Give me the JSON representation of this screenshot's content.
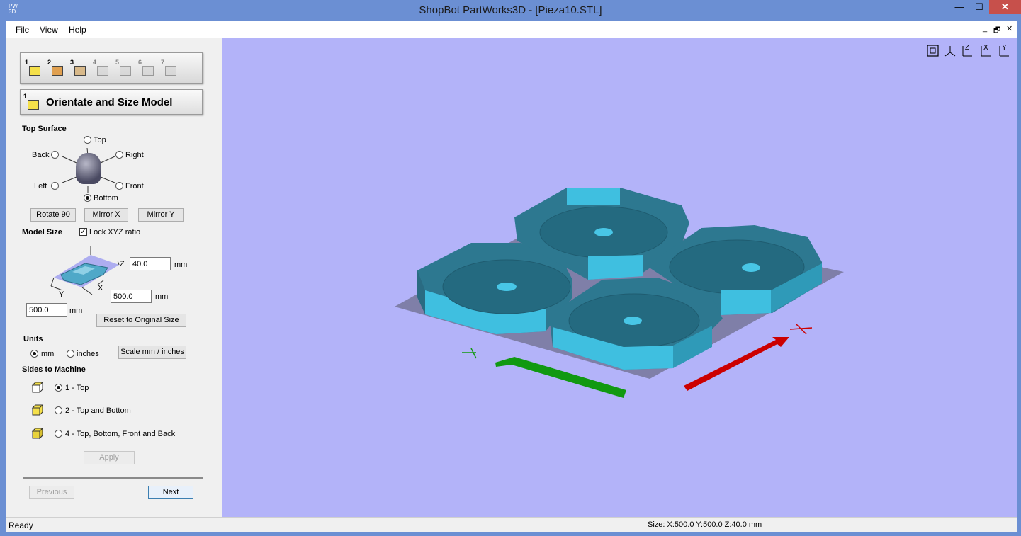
{
  "window": {
    "title": "ShopBot PartWorks3D - [Pieza10.STL]",
    "app_icon_text": "PW\n3D",
    "minimize": "—",
    "maximize": "☐",
    "close": "✕"
  },
  "menu": {
    "items": [
      "File",
      "View",
      "Help"
    ],
    "mdi_controls": [
      "_",
      "🗗",
      "✕"
    ]
  },
  "wizard": {
    "steps": [
      "1",
      "2",
      "3",
      "4",
      "5",
      "6",
      "7"
    ],
    "heading_number": "1",
    "heading": "Orientate and Size Model"
  },
  "top_surface": {
    "label": "Top Surface",
    "options": {
      "top": "Top",
      "back": "Back",
      "right": "Right",
      "left": "Left",
      "front": "Front",
      "bottom": "Bottom"
    },
    "selected": "Bottom",
    "buttons": {
      "rotate": "Rotate 90",
      "mirror_x": "Mirror X",
      "mirror_y": "Mirror Y"
    }
  },
  "model_size": {
    "label": "Model Size",
    "lock_label": "Lock XYZ ratio",
    "lock_checked": true,
    "axis_z": "Z",
    "axis_x": "X",
    "axis_y": "Y",
    "z_value": "40.0",
    "x_value": "500.0",
    "y_value": "500.0",
    "unit": "mm",
    "reset_button": "Reset to Original Size"
  },
  "units": {
    "label": "Units",
    "mm": "mm",
    "inches": "inches",
    "selected": "mm",
    "scale_button": "Scale mm / inches"
  },
  "sides": {
    "label": "Sides to Machine",
    "options": [
      "1 - Top",
      "2 - Top and Bottom",
      "4 - Top, Bottom, Front and Back"
    ],
    "selected_index": 0,
    "apply_button": "Apply"
  },
  "nav": {
    "previous": "Previous",
    "next": "Next"
  },
  "status": {
    "left": "Ready",
    "right": "Size: X:500.0 Y:500.0 Z:40.0 mm"
  },
  "view_icons": [
    "zoom-extents-icon",
    "iso-view-icon",
    "view-z-icon",
    "view-x-icon",
    "view-y-icon"
  ],
  "view_icon_letters": [
    "",
    "",
    "Z",
    "X",
    "Y"
  ],
  "colors": {
    "viewport_bg": "#b3b3f9",
    "model_top": "#2f7f95",
    "model_side": "#40c0e0",
    "x_arrow": "#cc0000",
    "y_arrow": "#119911"
  }
}
